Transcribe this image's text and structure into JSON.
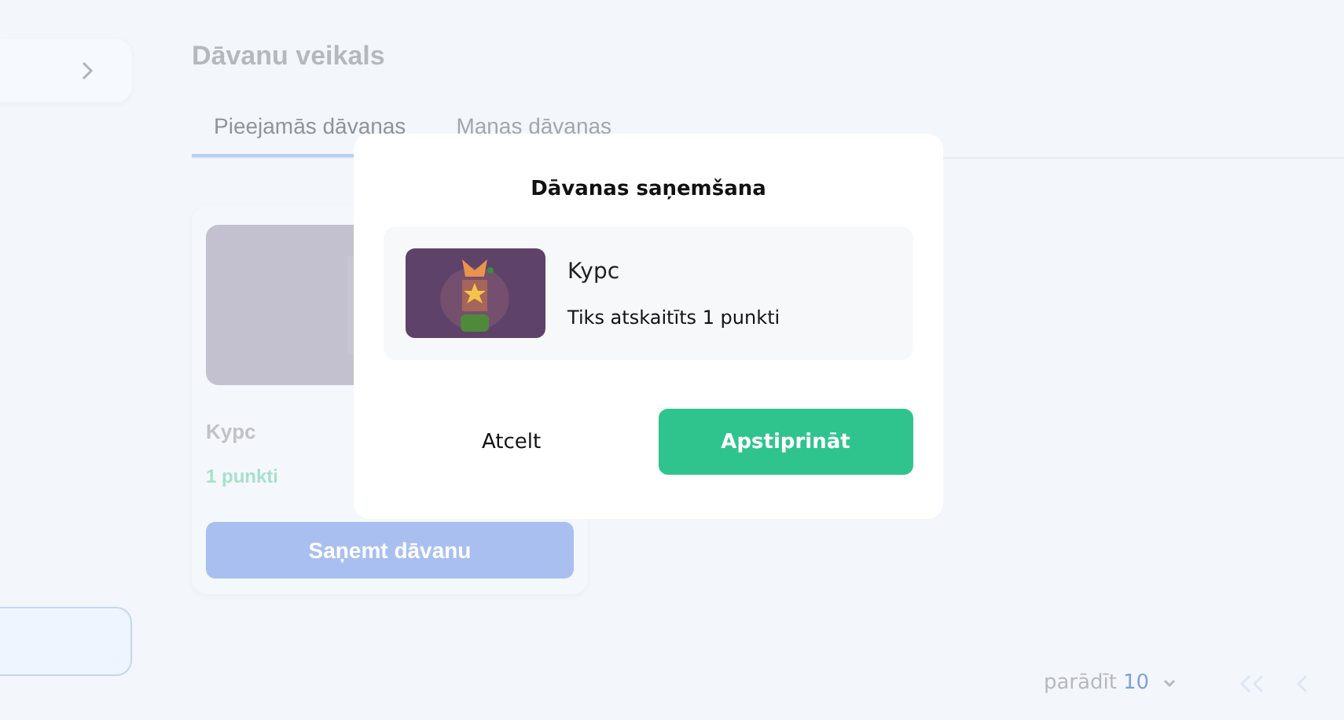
{
  "page": {
    "title": "Dāvanu veikals"
  },
  "tabs": [
    {
      "label": "Pieejamās dāvanas",
      "selected": true
    },
    {
      "label": "Manas dāvanas",
      "selected": false
    }
  ],
  "gifts": [
    {
      "name": "Kypc",
      "price": "1 punkti",
      "action": "Saņemt dāvanu"
    }
  ],
  "pagination": {
    "label": "parādīt",
    "page_size": "10"
  },
  "dialog": {
    "title": "Dāvanas saņemšana",
    "item": {
      "name": "Kypc",
      "note": "Tiks atskaitīts 1 punkti"
    },
    "cancel": "Atcelt",
    "confirm": "Apstiprināt"
  }
}
